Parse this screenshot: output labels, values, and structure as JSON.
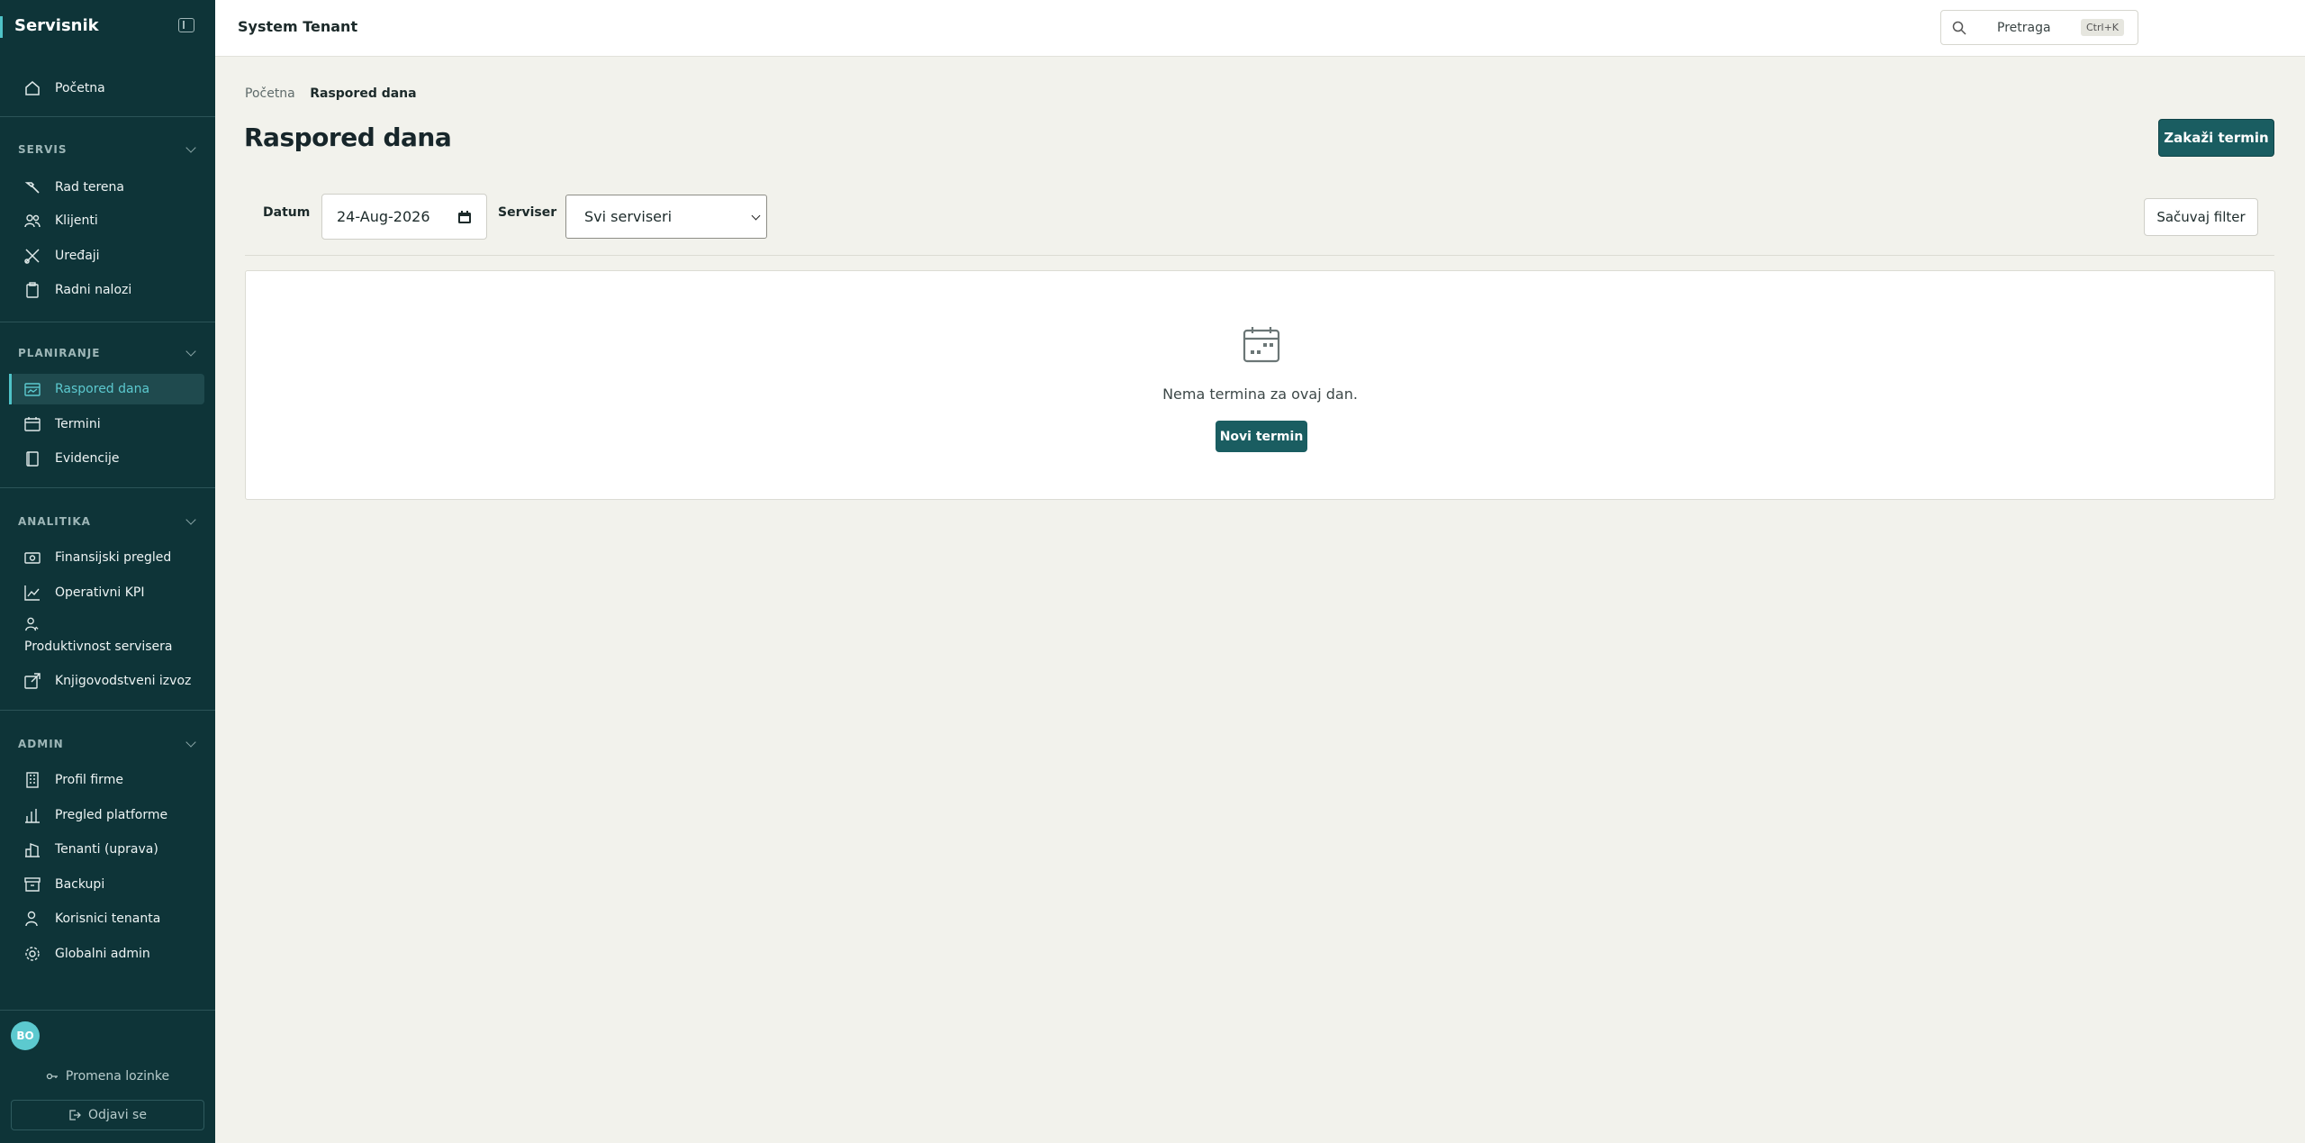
{
  "sidebar": {
    "brand": "Servisnik",
    "home": "Početna",
    "sections": {
      "servis": "SERVIS",
      "planiranje": "PLANIRANJE",
      "analitika": "ANALITIKA",
      "admin": "ADMIN"
    },
    "items": {
      "rad_terena": "Rad terena",
      "klijenti": "Klijenti",
      "uredjaji": "Uređaji",
      "radni_nalozi": "Radni nalozi",
      "raspored_dana": "Raspored dana",
      "termini": "Termini",
      "evidencije": "Evidencije",
      "finansijski_pregled": "Finansijski pregled",
      "operativni_kpi": "Operativni KPI",
      "produktivnost_servisera": "Produktivnost servisera",
      "knjigovodstveni_izvoz": "Knjigovodstveni izvoz",
      "profil_firme": "Profil firme",
      "pregled_platforme": "Pregled platforme",
      "tenanti_uprava": "Tenanti (uprava)",
      "backupi": "Backupi",
      "korisnici_tenanta": "Korisnici tenanta",
      "globalni_admin": "Globalni admin"
    },
    "active_item": "Raspored dana",
    "user_initials": "BO",
    "change_password": "Promena lozinke",
    "logout": "Odjavi se"
  },
  "header": {
    "tenant": "System Tenant",
    "search_placeholder": "Pretraga",
    "search_shortcut": "Ctrl+K"
  },
  "main": {
    "breadcrumb": {
      "home": "Početna",
      "current": "Raspored dana"
    },
    "title": "Raspored dana",
    "primary_action": "Zakaži termin",
    "filters": {
      "date_label": "Datum",
      "date_value": "24-Aug-2026",
      "technician_label": "Serviser",
      "technician_value": "Svi serviseri",
      "save_filter": "Sačuvaj filter"
    },
    "empty_state": {
      "message": "Nema termina za ovaj dan.",
      "button": "Novi termin"
    }
  },
  "colors": {
    "sidebar_bg": "#0e3438",
    "accent": "#4fc3c8",
    "primary": "#1a5d61",
    "page_bg": "#f2f2ec"
  }
}
